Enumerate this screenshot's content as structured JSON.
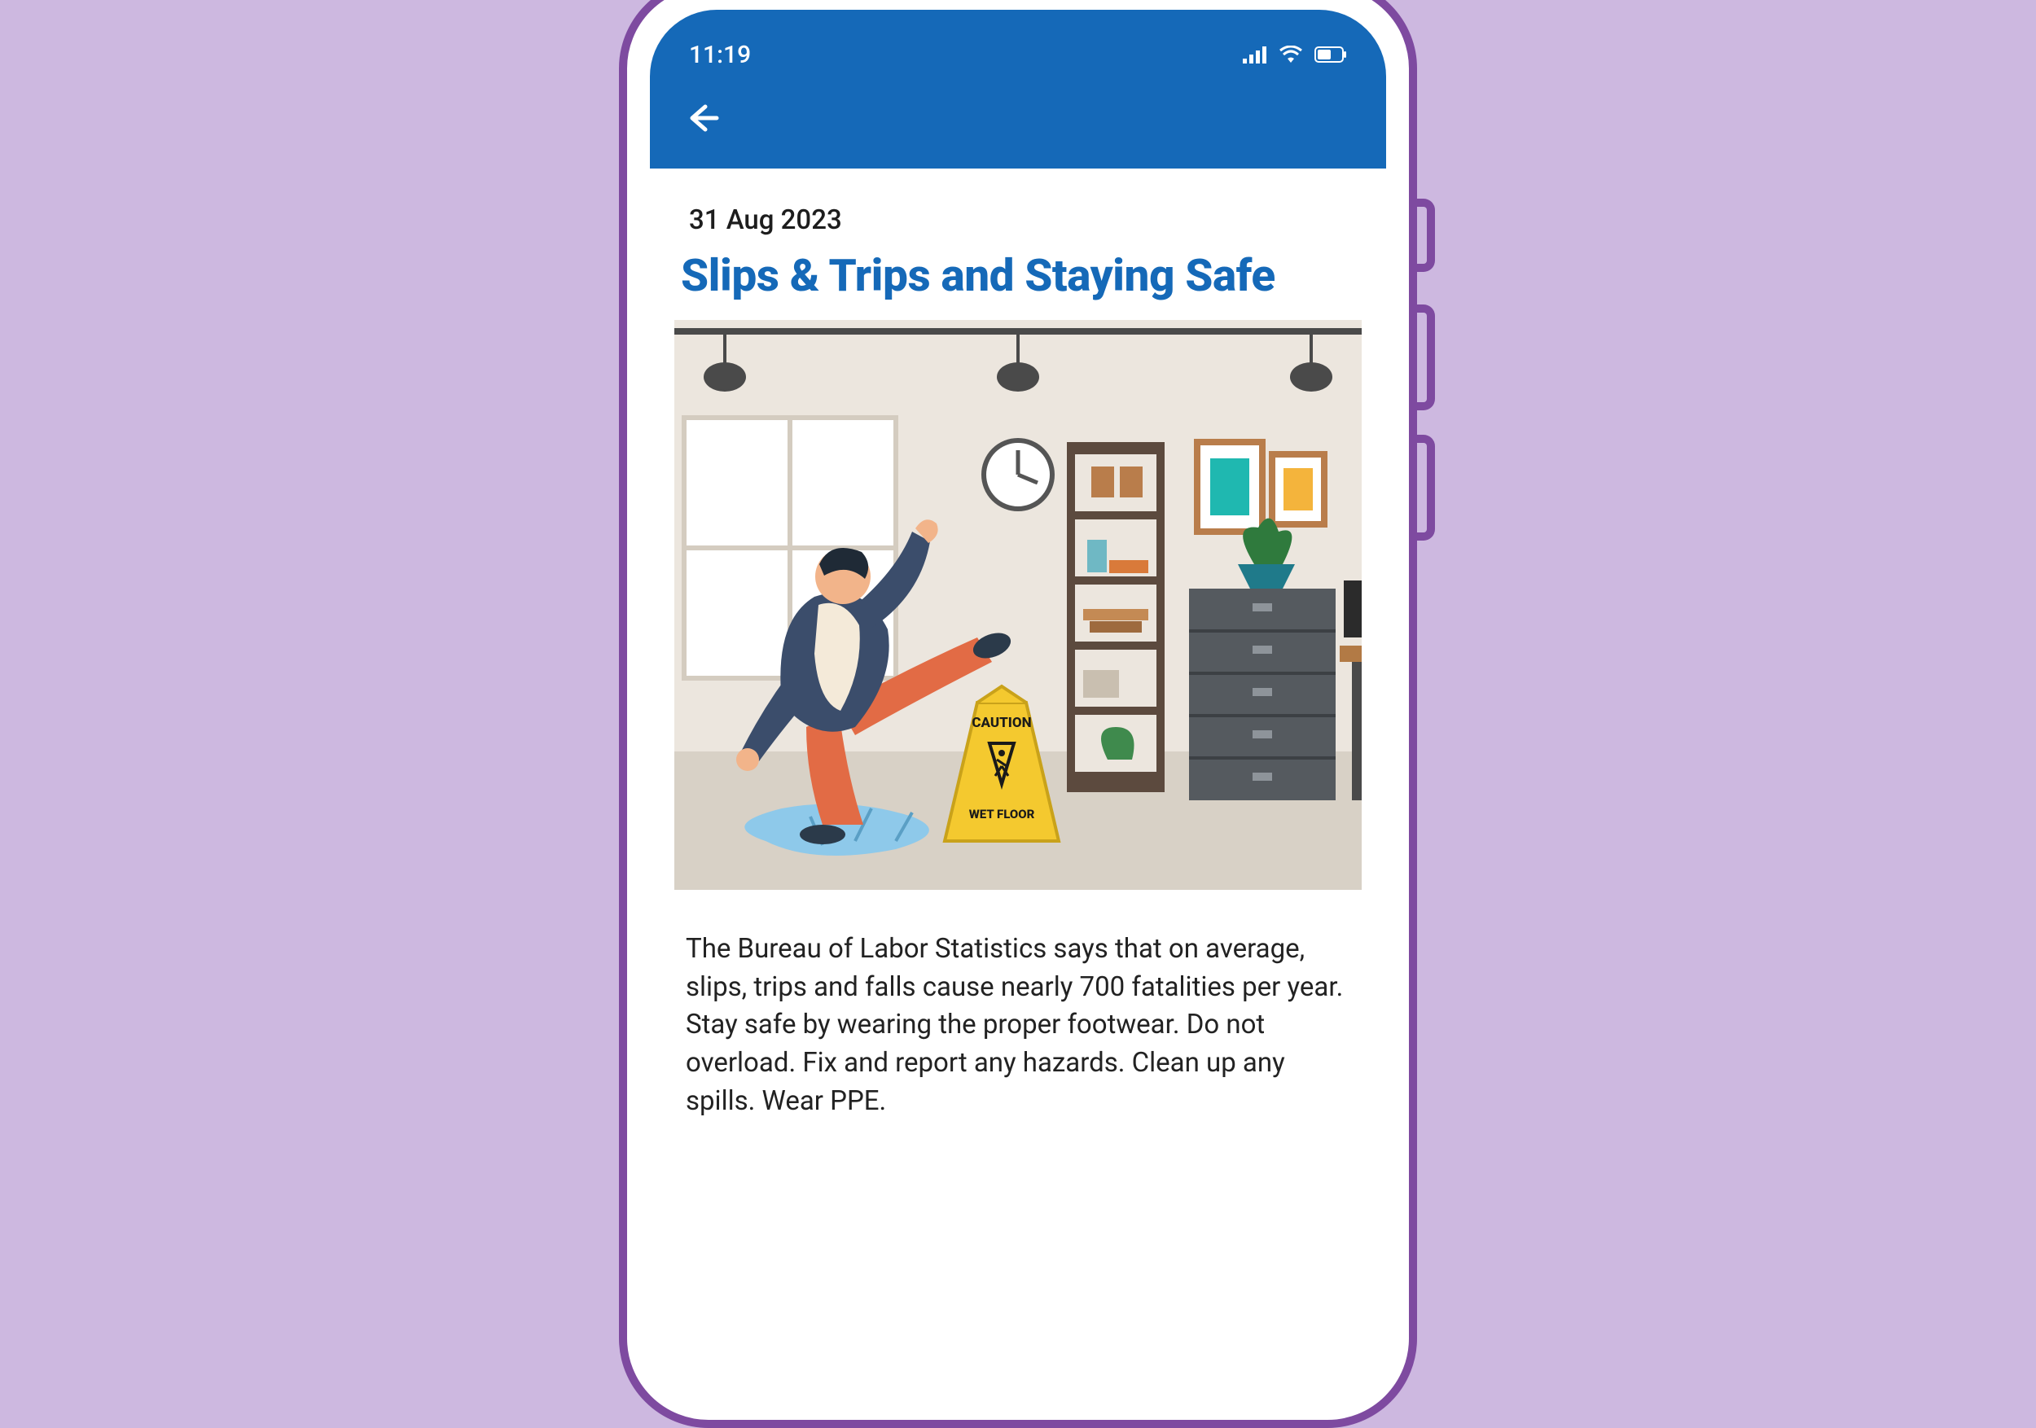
{
  "status": {
    "time": "11:19"
  },
  "article": {
    "date": "31 Aug 2023",
    "title": "Slips & Trips and Staying Safe",
    "body": "The Bureau of Labor Statistics says that on average, slips, trips and falls cause nearly 700 fatalities per year. Stay safe by wearing the proper footwear. Do not overload. Fix and report any hazards. Clean up any spills. Wear PPE.",
    "illustration": {
      "caution_sign_top": "CAUTION",
      "caution_sign_bottom": "WET FLOOR"
    }
  },
  "colors": {
    "background": "#cdb8e0",
    "phone_outline": "#7e4aa0",
    "header": "#1569b8",
    "title": "#1569b8"
  }
}
